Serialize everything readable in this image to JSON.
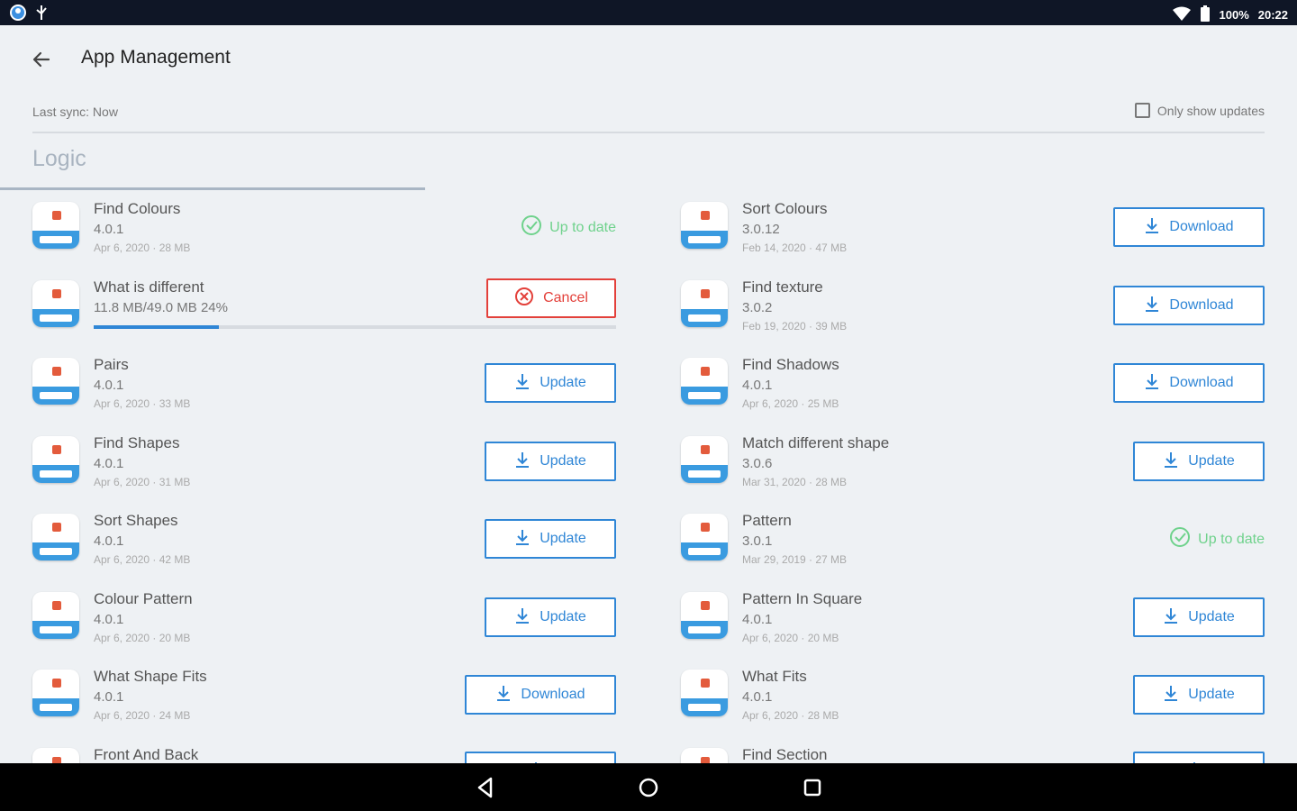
{
  "status_bar": {
    "battery": "100%",
    "time": "20:22",
    "icons": [
      "globe-icon",
      "usb-icon",
      "wifi-icon",
      "battery-icon"
    ]
  },
  "header": {
    "title": "App Management",
    "back_icon": "arrow-left-icon"
  },
  "sync": {
    "text": "Last sync: Now",
    "only_updates_label": "Only show updates",
    "only_updates_checked": false
  },
  "section": {
    "label": "Logic"
  },
  "apps_left": [
    {
      "name": "Find Colours",
      "version": "4.0.1",
      "meta": "Apr 6, 2020 · 28 MB",
      "status": "uptodate",
      "label": "Up to date"
    },
    {
      "name": "What is different",
      "progress_text": "11.8 MB/49.0 MB  24%",
      "progress": 0.24,
      "status": "cancel",
      "label": "Cancel"
    },
    {
      "name": "Pairs",
      "version": "4.0.1",
      "meta": "Apr 6, 2020 · 33 MB",
      "status": "update",
      "label": "Update"
    },
    {
      "name": "Find Shapes",
      "version": "4.0.1",
      "meta": "Apr 6, 2020 · 31 MB",
      "status": "update",
      "label": "Update"
    },
    {
      "name": "Sort Shapes",
      "version": "4.0.1",
      "meta": "Apr 6, 2020 · 42 MB",
      "status": "update",
      "label": "Update"
    },
    {
      "name": "Colour Pattern",
      "version": "4.0.1",
      "meta": "Apr 6, 2020 · 20 MB",
      "status": "update",
      "label": "Update"
    },
    {
      "name": "What Shape Fits",
      "version": "4.0.1",
      "meta": "Apr 6, 2020 · 24 MB",
      "status": "download",
      "label": "Download"
    },
    {
      "name": "Front And Back",
      "version": "",
      "meta": "",
      "status": "download",
      "label": ""
    }
  ],
  "apps_right": [
    {
      "name": "Sort Colours",
      "version": "3.0.12",
      "meta": "Feb 14, 2020 · 47 MB",
      "status": "download",
      "label": "Download"
    },
    {
      "name": "Find texture",
      "version": "3.0.2",
      "meta": "Feb 19, 2020 · 39 MB",
      "status": "download",
      "label": "Download"
    },
    {
      "name": "Find Shadows",
      "version": "4.0.1",
      "meta": "Apr 6, 2020 · 25 MB",
      "status": "download",
      "label": "Download"
    },
    {
      "name": "Match different shape",
      "version": "3.0.6",
      "meta": "Mar 31, 2020 · 28 MB",
      "status": "update",
      "label": "Update"
    },
    {
      "name": "Pattern",
      "version": "3.0.1",
      "meta": "Mar 29, 2019 · 27 MB",
      "status": "uptodate",
      "label": "Up to date"
    },
    {
      "name": "Pattern In Square",
      "version": "4.0.1",
      "meta": "Apr 6, 2020 · 20 MB",
      "status": "update",
      "label": "Update"
    },
    {
      "name": "What Fits",
      "version": "4.0.1",
      "meta": "Apr 6, 2020 · 28 MB",
      "status": "update",
      "label": "Update"
    },
    {
      "name": "Find Section",
      "version": "",
      "meta": "",
      "status": "update",
      "label": ""
    }
  ],
  "nav_bar": {
    "icons": [
      "back-triangle-icon",
      "home-circle-icon",
      "recents-square-icon"
    ]
  },
  "colors": {
    "accent": "#2f86d6",
    "cancel": "#e3403a",
    "uptodate": "#6fd28c",
    "background": "#eef1f4"
  }
}
